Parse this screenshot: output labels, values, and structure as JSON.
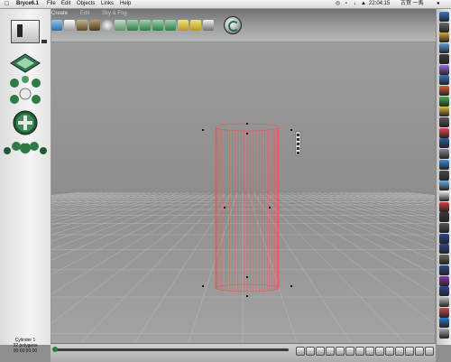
{
  "menubar": {
    "app_name": "Bryce6.1",
    "menus": [
      "File",
      "Edit",
      "Objects",
      "Links",
      "Help"
    ],
    "clock": "22:04:15",
    "user": "古賀 一馬"
  },
  "palette": {
    "tabs": [
      "Create",
      "Edit",
      "Sky & Fog"
    ]
  },
  "selection": {
    "name": "Cylinder 1",
    "polygons": "32 polygons",
    "timecode": "00:00:00.00"
  },
  "colors": {
    "wireframe": "#e45a5a",
    "accent_green": "#2e7a45",
    "ground": "#8f8f8f"
  }
}
